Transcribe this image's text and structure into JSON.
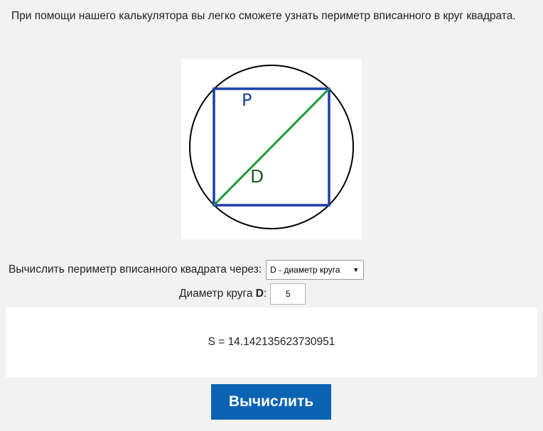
{
  "intro": {
    "text": "При помощи нашего калькулятора вы легко сможете узнать периметр вписанного в круг квадрата."
  },
  "diagram": {
    "square_label": "P",
    "diagonal_label": "D",
    "colors": {
      "circle": "#000000",
      "square": "#1a3fa8",
      "diagonal": "#1e9a3a",
      "label_p": "#1a3fa8",
      "label_d": "#1d5e24"
    }
  },
  "form": {
    "method_label": "Вычислить периметр вписанного квадрата через:",
    "method_selected": "D - диаметр круга",
    "diameter_label_prefix": "Диаметр круга ",
    "diameter_label_var": "D",
    "diameter_label_suffix": ":",
    "diameter_value": "5"
  },
  "result": {
    "text": "S = 14.142135623730951"
  },
  "button": {
    "label": "Вычислить",
    "color": "#0b63b3"
  }
}
